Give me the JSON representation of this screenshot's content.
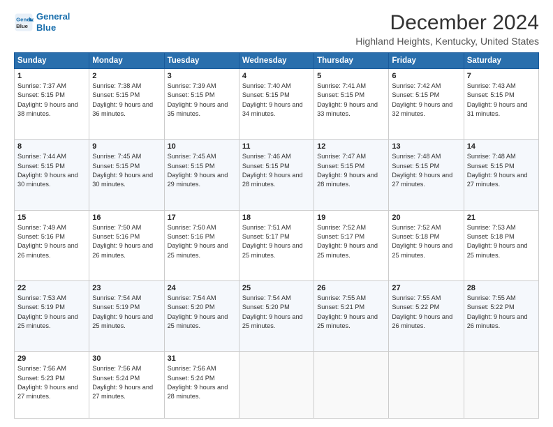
{
  "app": {
    "logo_line1": "General",
    "logo_line2": "Blue"
  },
  "header": {
    "title": "December 2024",
    "subtitle": "Highland Heights, Kentucky, United States"
  },
  "weekdays": [
    "Sunday",
    "Monday",
    "Tuesday",
    "Wednesday",
    "Thursday",
    "Friday",
    "Saturday"
  ],
  "weeks": [
    [
      {
        "day": "1",
        "sunrise": "Sunrise: 7:37 AM",
        "sunset": "Sunset: 5:15 PM",
        "daylight": "Daylight: 9 hours and 38 minutes."
      },
      {
        "day": "2",
        "sunrise": "Sunrise: 7:38 AM",
        "sunset": "Sunset: 5:15 PM",
        "daylight": "Daylight: 9 hours and 36 minutes."
      },
      {
        "day": "3",
        "sunrise": "Sunrise: 7:39 AM",
        "sunset": "Sunset: 5:15 PM",
        "daylight": "Daylight: 9 hours and 35 minutes."
      },
      {
        "day": "4",
        "sunrise": "Sunrise: 7:40 AM",
        "sunset": "Sunset: 5:15 PM",
        "daylight": "Daylight: 9 hours and 34 minutes."
      },
      {
        "day": "5",
        "sunrise": "Sunrise: 7:41 AM",
        "sunset": "Sunset: 5:15 PM",
        "daylight": "Daylight: 9 hours and 33 minutes."
      },
      {
        "day": "6",
        "sunrise": "Sunrise: 7:42 AM",
        "sunset": "Sunset: 5:15 PM",
        "daylight": "Daylight: 9 hours and 32 minutes."
      },
      {
        "day": "7",
        "sunrise": "Sunrise: 7:43 AM",
        "sunset": "Sunset: 5:15 PM",
        "daylight": "Daylight: 9 hours and 31 minutes."
      }
    ],
    [
      {
        "day": "8",
        "sunrise": "Sunrise: 7:44 AM",
        "sunset": "Sunset: 5:15 PM",
        "daylight": "Daylight: 9 hours and 30 minutes."
      },
      {
        "day": "9",
        "sunrise": "Sunrise: 7:45 AM",
        "sunset": "Sunset: 5:15 PM",
        "daylight": "Daylight: 9 hours and 30 minutes."
      },
      {
        "day": "10",
        "sunrise": "Sunrise: 7:45 AM",
        "sunset": "Sunset: 5:15 PM",
        "daylight": "Daylight: 9 hours and 29 minutes."
      },
      {
        "day": "11",
        "sunrise": "Sunrise: 7:46 AM",
        "sunset": "Sunset: 5:15 PM",
        "daylight": "Daylight: 9 hours and 28 minutes."
      },
      {
        "day": "12",
        "sunrise": "Sunrise: 7:47 AM",
        "sunset": "Sunset: 5:15 PM",
        "daylight": "Daylight: 9 hours and 28 minutes."
      },
      {
        "day": "13",
        "sunrise": "Sunrise: 7:48 AM",
        "sunset": "Sunset: 5:15 PM",
        "daylight": "Daylight: 9 hours and 27 minutes."
      },
      {
        "day": "14",
        "sunrise": "Sunrise: 7:48 AM",
        "sunset": "Sunset: 5:15 PM",
        "daylight": "Daylight: 9 hours and 27 minutes."
      }
    ],
    [
      {
        "day": "15",
        "sunrise": "Sunrise: 7:49 AM",
        "sunset": "Sunset: 5:16 PM",
        "daylight": "Daylight: 9 hours and 26 minutes."
      },
      {
        "day": "16",
        "sunrise": "Sunrise: 7:50 AM",
        "sunset": "Sunset: 5:16 PM",
        "daylight": "Daylight: 9 hours and 26 minutes."
      },
      {
        "day": "17",
        "sunrise": "Sunrise: 7:50 AM",
        "sunset": "Sunset: 5:16 PM",
        "daylight": "Daylight: 9 hours and 25 minutes."
      },
      {
        "day": "18",
        "sunrise": "Sunrise: 7:51 AM",
        "sunset": "Sunset: 5:17 PM",
        "daylight": "Daylight: 9 hours and 25 minutes."
      },
      {
        "day": "19",
        "sunrise": "Sunrise: 7:52 AM",
        "sunset": "Sunset: 5:17 PM",
        "daylight": "Daylight: 9 hours and 25 minutes."
      },
      {
        "day": "20",
        "sunrise": "Sunrise: 7:52 AM",
        "sunset": "Sunset: 5:18 PM",
        "daylight": "Daylight: 9 hours and 25 minutes."
      },
      {
        "day": "21",
        "sunrise": "Sunrise: 7:53 AM",
        "sunset": "Sunset: 5:18 PM",
        "daylight": "Daylight: 9 hours and 25 minutes."
      }
    ],
    [
      {
        "day": "22",
        "sunrise": "Sunrise: 7:53 AM",
        "sunset": "Sunset: 5:19 PM",
        "daylight": "Daylight: 9 hours and 25 minutes."
      },
      {
        "day": "23",
        "sunrise": "Sunrise: 7:54 AM",
        "sunset": "Sunset: 5:19 PM",
        "daylight": "Daylight: 9 hours and 25 minutes."
      },
      {
        "day": "24",
        "sunrise": "Sunrise: 7:54 AM",
        "sunset": "Sunset: 5:20 PM",
        "daylight": "Daylight: 9 hours and 25 minutes."
      },
      {
        "day": "25",
        "sunrise": "Sunrise: 7:54 AM",
        "sunset": "Sunset: 5:20 PM",
        "daylight": "Daylight: 9 hours and 25 minutes."
      },
      {
        "day": "26",
        "sunrise": "Sunrise: 7:55 AM",
        "sunset": "Sunset: 5:21 PM",
        "daylight": "Daylight: 9 hours and 25 minutes."
      },
      {
        "day": "27",
        "sunrise": "Sunrise: 7:55 AM",
        "sunset": "Sunset: 5:22 PM",
        "daylight": "Daylight: 9 hours and 26 minutes."
      },
      {
        "day": "28",
        "sunrise": "Sunrise: 7:55 AM",
        "sunset": "Sunset: 5:22 PM",
        "daylight": "Daylight: 9 hours and 26 minutes."
      }
    ],
    [
      {
        "day": "29",
        "sunrise": "Sunrise: 7:56 AM",
        "sunset": "Sunset: 5:23 PM",
        "daylight": "Daylight: 9 hours and 27 minutes."
      },
      {
        "day": "30",
        "sunrise": "Sunrise: 7:56 AM",
        "sunset": "Sunset: 5:24 PM",
        "daylight": "Daylight: 9 hours and 27 minutes."
      },
      {
        "day": "31",
        "sunrise": "Sunrise: 7:56 AM",
        "sunset": "Sunset: 5:24 PM",
        "daylight": "Daylight: 9 hours and 28 minutes."
      },
      null,
      null,
      null,
      null
    ]
  ]
}
